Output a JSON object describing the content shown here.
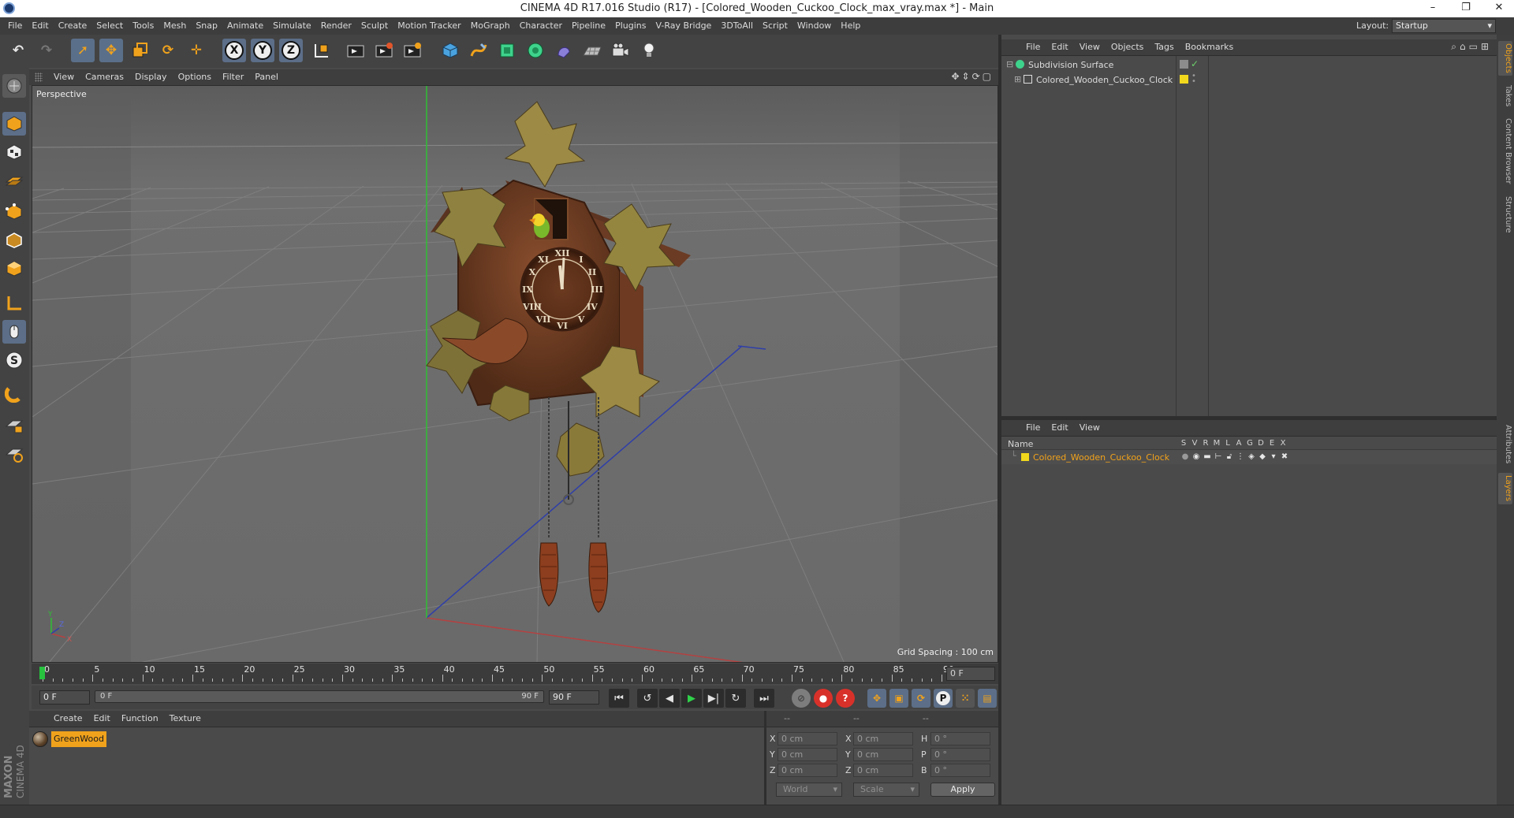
{
  "window": {
    "title": "CINEMA 4D R17.016 Studio (R17) - [Colored_Wooden_Cuckoo_Clock_max_vray.max *] - Main",
    "controls": [
      "–",
      "❐",
      "✕"
    ]
  },
  "menubar": {
    "items": [
      "File",
      "Edit",
      "Create",
      "Select",
      "Tools",
      "Mesh",
      "Snap",
      "Animate",
      "Simulate",
      "Render",
      "Sculpt",
      "Motion Tracker",
      "MoGraph",
      "Character",
      "Pipeline",
      "Plugins",
      "V-Ray Bridge",
      "3DToAll",
      "Script",
      "Window",
      "Help"
    ],
    "layout_label": "Layout:",
    "layout_value": "Startup"
  },
  "toolbar": {
    "axis_x": "X",
    "axis_y": "Y",
    "axis_z": "Z"
  },
  "viewport": {
    "menu": [
      "View",
      "Cameras",
      "Display",
      "Options",
      "Filter",
      "Panel"
    ],
    "camera_label": "Perspective",
    "grid_spacing": "Grid Spacing : 100 cm",
    "axis_labels": {
      "y": "Y",
      "x": "X",
      "z": "Z"
    }
  },
  "timeline": {
    "ticks": [
      "0",
      "5",
      "10",
      "15",
      "20",
      "25",
      "30",
      "35",
      "40",
      "45",
      "50",
      "55",
      "60",
      "65",
      "70",
      "75",
      "80",
      "85",
      "90"
    ],
    "current_frame": "0 F"
  },
  "transport": {
    "start_field": "0 F",
    "range_start": "0 F",
    "range_end": "90 F",
    "end_field": "90 F"
  },
  "material_manager": {
    "menu": [
      "Create",
      "Edit",
      "Function",
      "Texture"
    ],
    "materials": [
      {
        "name": "GreenWood"
      }
    ]
  },
  "coordinates": {
    "header": [
      "--",
      "--",
      "--"
    ],
    "rows": [
      {
        "axis": "X",
        "pos": "0 cm",
        "size_axis": "X",
        "size": "0 cm",
        "rot_axis": "H",
        "rot": "0 °"
      },
      {
        "axis": "Y",
        "pos": "0 cm",
        "size_axis": "Y",
        "size": "0 cm",
        "rot_axis": "P",
        "rot": "0 °"
      },
      {
        "axis": "Z",
        "pos": "0 cm",
        "size_axis": "Z",
        "size": "0 cm",
        "rot_axis": "B",
        "rot": "0 °"
      }
    ],
    "space_select": "World",
    "mode_select": "Scale",
    "apply_label": "Apply"
  },
  "object_manager": {
    "menu": [
      "File",
      "Edit",
      "View",
      "Objects",
      "Tags",
      "Bookmarks"
    ],
    "objects": [
      {
        "name": "Subdivision Surface"
      },
      {
        "name": "Colored_Wooden_Cuckoo_Clock"
      }
    ]
  },
  "layer_manager": {
    "menu": [
      "File",
      "Edit",
      "View"
    ],
    "name_header": "Name",
    "columns": [
      "S",
      "V",
      "R",
      "M",
      "L",
      "A",
      "G",
      "D",
      "E",
      "X"
    ],
    "layers": [
      {
        "name": "Colored_Wooden_Cuckoo_Clock",
        "color": "#f2d81d"
      }
    ]
  },
  "side_tabs": [
    "Objects",
    "Takes",
    "Content Browser",
    "Structure",
    "Attributes",
    "Layers"
  ],
  "branding": {
    "logo_top": "MAXON",
    "logo_bottom": "CINEMA 4D"
  },
  "colors": {
    "accent": "#f0a21c",
    "layer_yellow": "#f2d81d",
    "playhead_green": "#27c23e",
    "panel_bg": "#4a4a4a"
  }
}
